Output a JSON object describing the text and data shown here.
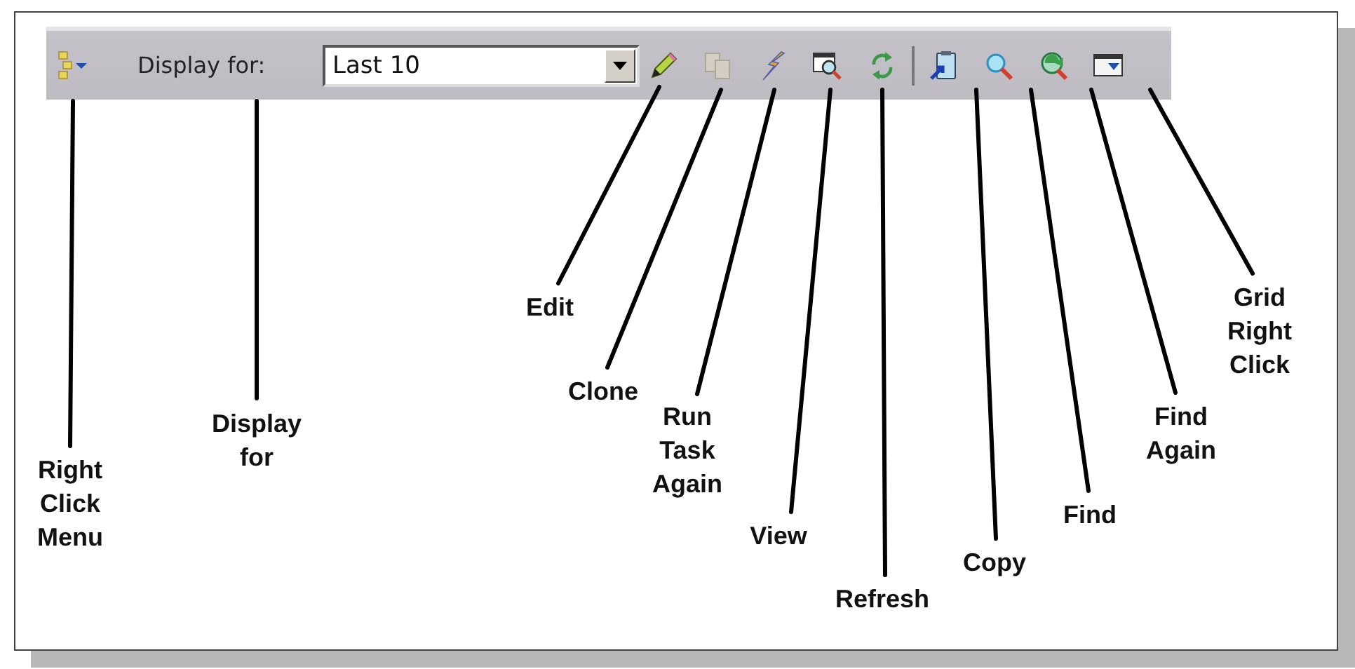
{
  "toolbar": {
    "items": [
      {
        "kind": "menu"
      },
      {
        "kind": "label",
        "text": "Display for:"
      },
      {
        "kind": "dropdown",
        "value": "Last 10"
      },
      {
        "kind": "button",
        "disabled": false
      },
      {
        "kind": "button",
        "disabled": true
      },
      {
        "kind": "button",
        "disabled": false
      },
      {
        "kind": "button",
        "disabled": false
      },
      {
        "kind": "button",
        "disabled": false
      },
      {
        "kind": "separator"
      },
      {
        "kind": "button",
        "disabled": false
      },
      {
        "kind": "button",
        "disabled": false
      },
      {
        "kind": "button",
        "disabled": false
      },
      {
        "kind": "button",
        "disabled": false
      }
    ]
  },
  "callouts": [
    {
      "label": "Right Click Menu"
    },
    {
      "label": "Display for"
    },
    {
      "label": "Edit"
    },
    {
      "label": "Clone"
    },
    {
      "label": "Run Task Again"
    },
    {
      "label": "View"
    },
    {
      "label": "Refresh"
    },
    {
      "label": "Copy"
    },
    {
      "label": "Find"
    },
    {
      "label": "Find Again"
    },
    {
      "label": "Grid Right Click"
    }
  ]
}
